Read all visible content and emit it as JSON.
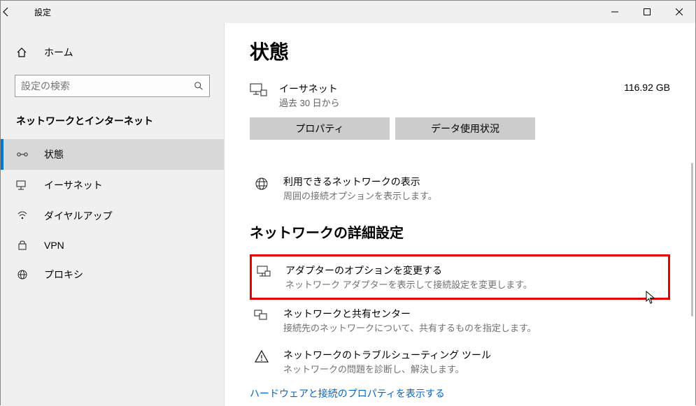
{
  "window": {
    "title": "設定"
  },
  "sidebar": {
    "home": "ホーム",
    "search_placeholder": "設定の検索",
    "category": "ネットワークとインターネット",
    "items": [
      {
        "label": "状態"
      },
      {
        "label": "イーサネット"
      },
      {
        "label": "ダイヤルアップ"
      },
      {
        "label": "VPN"
      },
      {
        "label": "プロキシ"
      }
    ]
  },
  "content": {
    "heading": "状態",
    "network": {
      "name": "イーサネット",
      "sub": "過去 30 日から",
      "usage": "116.92 GB",
      "btn_properties": "プロパティ",
      "btn_usage": "データ使用状況"
    },
    "show_networks": {
      "title": "利用できるネットワークの表示",
      "sub": "周囲の接続オプションを表示します。"
    },
    "section": "ネットワークの詳細設定",
    "adapter": {
      "title": "アダプターのオプションを変更する",
      "sub": "ネットワーク アダプターを表示して接続設定を変更します。"
    },
    "sharing": {
      "title": "ネットワークと共有センター",
      "sub": "接続先のネットワークについて、共有するものを指定します。"
    },
    "troubleshoot": {
      "title": "ネットワークのトラブルシューティング ツール",
      "sub": "ネットワークの問題を診断し、解決します。"
    },
    "hwlink": "ハードウェアと接続のプロパティを表示する"
  }
}
